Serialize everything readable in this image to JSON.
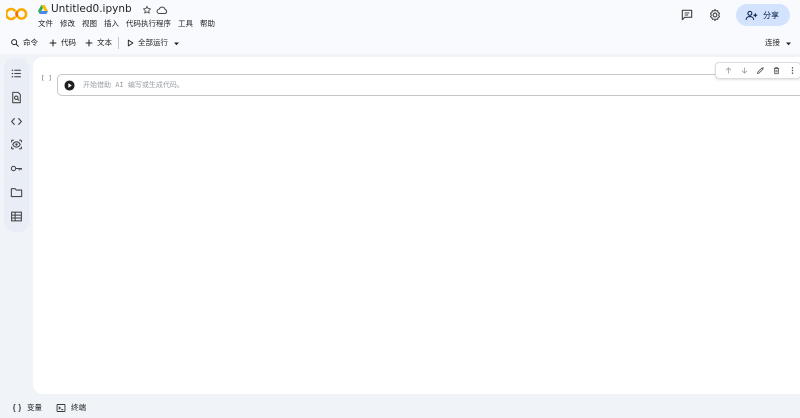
{
  "header": {
    "title": "Untitled0.ipynb",
    "menu": [
      "文件",
      "修改",
      "视图",
      "插入",
      "代码执行程序",
      "工具",
      "帮助"
    ],
    "share_label": "分享"
  },
  "toolbar": {
    "command_label": "命令",
    "add_code_label": "代码",
    "add_text_label": "文本",
    "run_all_label": "全部运行",
    "connect_label": "连接"
  },
  "cell": {
    "exec_count": "[ ]",
    "value": "",
    "placeholder": "开始借助 AI 编写或生成代码。"
  },
  "statusbar": {
    "variables_label": "变量",
    "terminal_label": "终端"
  },
  "colors": {
    "accent": "#f9ab00",
    "share_bg": "#d3e3fd",
    "page_bg": "#f0f4f9",
    "panel_bg": "#ffffff"
  },
  "icons": {
    "rail": [
      "table-of-contents-icon",
      "search-notebook-icon",
      "code-snippets-icon",
      "secrets-icon",
      "key-icon",
      "folder-icon",
      "data-table-icon"
    ],
    "cell_tools": [
      "move-up-icon",
      "move-down-icon",
      "edit-icon",
      "delete-icon",
      "more-icon"
    ]
  }
}
